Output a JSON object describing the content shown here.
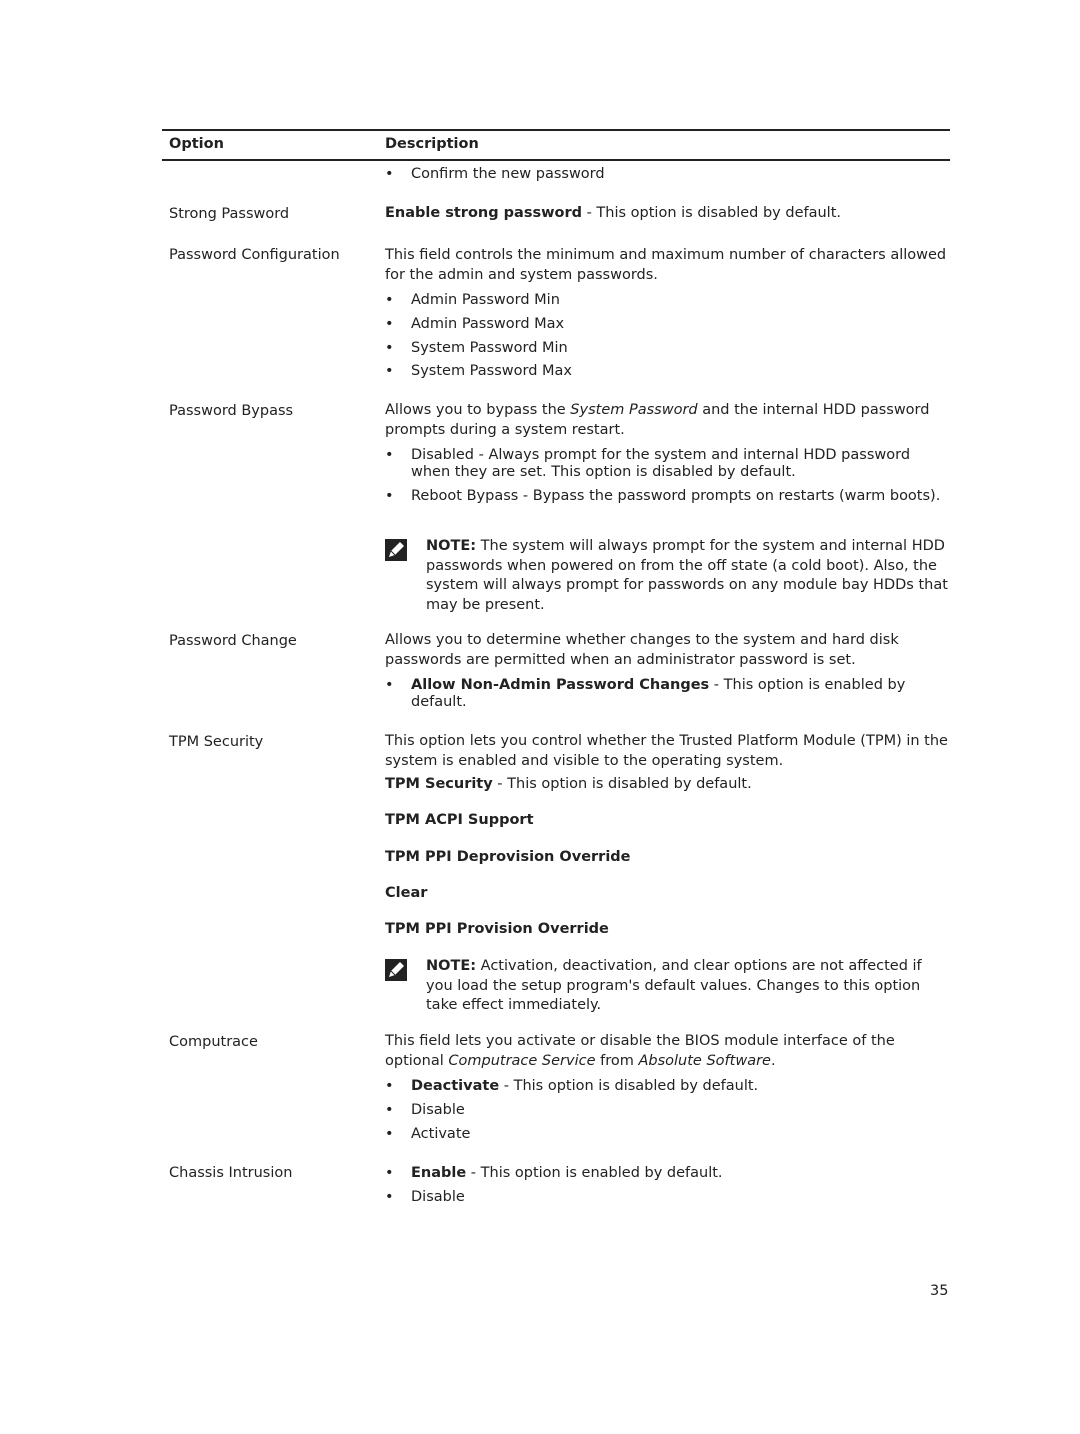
{
  "header": {
    "option": "Option",
    "description": "Description"
  },
  "rows": {
    "r0": {
      "bullets": [
        "Confirm the new password"
      ]
    },
    "strong": {
      "option": "Strong Password",
      "bold": "Enable strong password",
      "rest": " - This option is disabled by default."
    },
    "config": {
      "option": "Password Configuration",
      "desc": "This field controls the minimum and maximum number of characters allowed for the admin and system passwords.",
      "bullets": [
        "Admin Password Min",
        "Admin Password Max",
        "System Password Min",
        "System Password Max"
      ]
    },
    "bypass": {
      "option": "Password Bypass",
      "desc_a": "Allows you to bypass the ",
      "desc_i": "System Password",
      "desc_b": " and the internal HDD password prompts during a system restart.",
      "bullets": [
        "Disabled - Always prompt for the system and internal HDD password when they are set. This option is disabled by default.",
        "Reboot Bypass - Bypass the password prompts on restarts (warm boots)."
      ],
      "note_label": "NOTE:",
      "note": " The system will always prompt for the system and internal HDD passwords when powered on from the off state (a cold boot). Also, the system will always prompt for passwords on any module bay HDDs that may be present."
    },
    "change": {
      "option": "Password Change",
      "desc": "Allows you to determine whether changes to the system and hard disk passwords are permitted when an administrator password is set.",
      "bold": "Allow Non-Admin Password Changes",
      "rest": " - This option is enabled by default."
    },
    "tpm": {
      "option": "TPM Security",
      "desc": "This option lets you control whether the Trusted Platform Module (TPM) in the system is enabled and visible to the operating system.",
      "bold": "TPM Security",
      "rest": " - This option is disabled by default.",
      "items": [
        "TPM ACPI Support",
        "TPM PPI Deprovision Override",
        "Clear",
        "TPM PPI Provision Override"
      ],
      "note_label": "NOTE:",
      "note": " Activation, deactivation, and clear options are not affected if you load the setup program's default values. Changes to this option take effect immediately."
    },
    "computrace": {
      "option": "Computrace",
      "desc_a": "This field lets you activate or disable the BIOS module interface of the optional ",
      "desc_i1": "Computrace Service",
      "desc_b": " from ",
      "desc_i2": "Absolute Software",
      "desc_c": ".",
      "bold": "Deactivate",
      "rest": " - This option is disabled by default.",
      "bullets": [
        "Disable",
        "Activate"
      ]
    },
    "chassis": {
      "option": "Chassis Intrusion",
      "bold": "Enable",
      "rest": " - This option is enabled by default.",
      "bullets": [
        "Disable"
      ]
    }
  },
  "bullet_char": "•",
  "page_number": "35"
}
